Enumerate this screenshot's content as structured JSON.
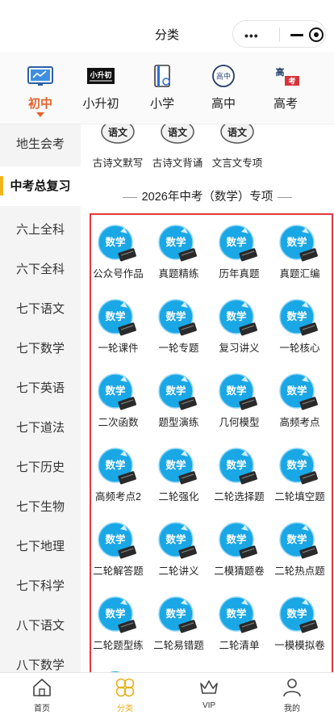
{
  "header": {
    "title": "分类",
    "more_glyph": "•••"
  },
  "levels": [
    {
      "label": "初中",
      "icon": "monitor-icon",
      "active": true
    },
    {
      "label": "小升初",
      "icon": "banner-icon",
      "active": false
    },
    {
      "label": "小学",
      "icon": "book-icon",
      "active": false
    },
    {
      "label": "高中",
      "icon": "gaozhong-badge-icon",
      "active": false
    },
    {
      "label": "高考",
      "icon": "gaokao-logo-icon",
      "active": false
    }
  ],
  "sidebar": {
    "items": [
      {
        "label": "地生会考",
        "active": false
      },
      {
        "label": "中考总复习",
        "active": true
      },
      {
        "label": "六上全科",
        "active": false
      },
      {
        "label": "六下全科",
        "active": false
      },
      {
        "label": "七下语文",
        "active": false
      },
      {
        "label": "七下数学",
        "active": false
      },
      {
        "label": "七下英语",
        "active": false
      },
      {
        "label": "七下道法",
        "active": false
      },
      {
        "label": "七下历史",
        "active": false
      },
      {
        "label": "七下生物",
        "active": false
      },
      {
        "label": "七下地理",
        "active": false
      },
      {
        "label": "七下科学",
        "active": false
      },
      {
        "label": "八下语文",
        "active": false
      },
      {
        "label": "八下数学",
        "active": false
      }
    ]
  },
  "top_items": [
    {
      "label": "古诗文默写",
      "icon_text": "语文"
    },
    {
      "label": "古诗文背诵",
      "icon_text": "语文"
    },
    {
      "label": "文言文专项",
      "icon_text": "语文"
    }
  ],
  "section": {
    "title": "2026年中考（数学）专项"
  },
  "grid": {
    "icon_text": "数学",
    "items": [
      "公众号作品",
      "真题精练",
      "历年真题",
      "真题汇编",
      "一轮课件",
      "一轮专题",
      "复习讲义",
      "一轮核心",
      "二次函数",
      "题型演练",
      "几何模型",
      "高频考点",
      "高频考点2",
      "二轮强化",
      "二轮选择题",
      "二轮填空题",
      "二轮解答题",
      "二轮讲义",
      "二模猜题卷",
      "二轮热点题",
      "二轮题型练",
      "二轮易错题",
      "二轮清单",
      "一模模拟卷"
    ]
  },
  "tabbar": [
    {
      "label": "首页",
      "icon": "home-icon",
      "active": false
    },
    {
      "label": "分类",
      "icon": "category-icon",
      "active": true
    },
    {
      "label": "VIP",
      "icon": "crown-icon",
      "active": false
    },
    {
      "label": "我的",
      "icon": "user-icon",
      "active": false
    }
  ],
  "colors": {
    "accent": "#e8622a",
    "highlight": "#f1b51c",
    "frame": "#e3393d",
    "icon_blue": "#1aa7e6"
  }
}
